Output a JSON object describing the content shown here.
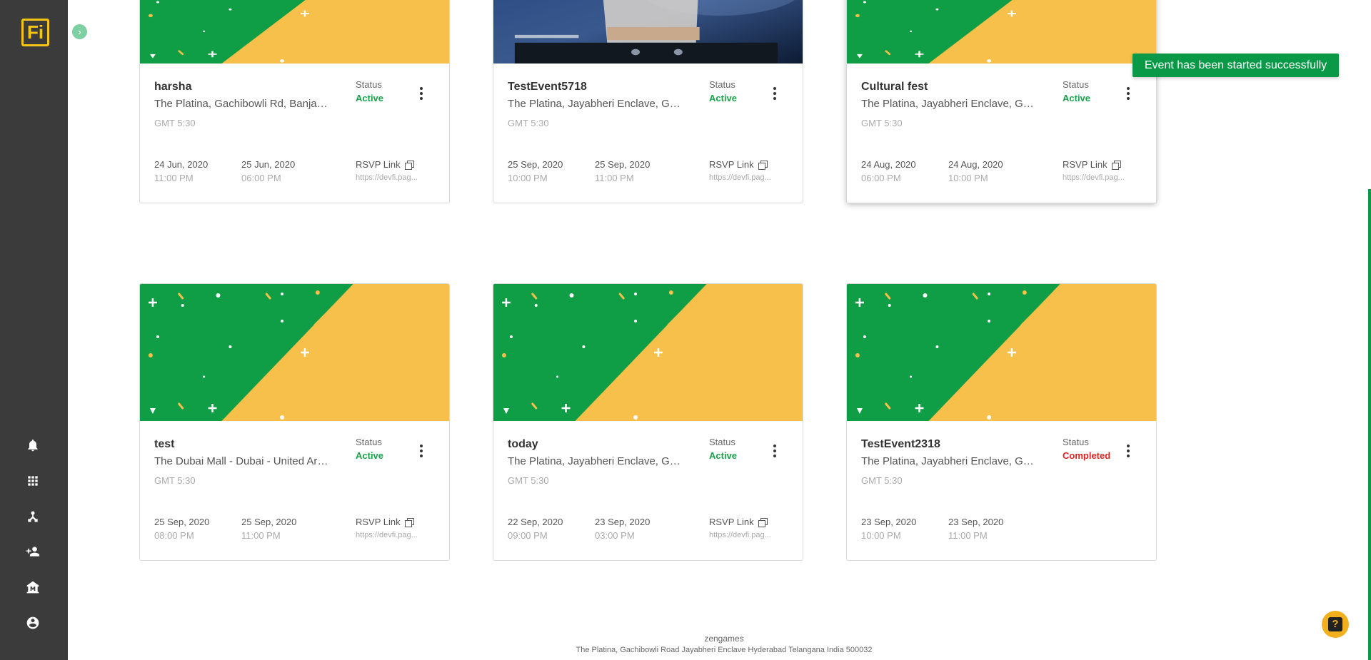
{
  "app": {
    "logo_text": "Fi",
    "toggle_glyph": "›"
  },
  "sidebar": {
    "icons": [
      "bell-icon",
      "grid-icon",
      "hub-icon",
      "add-user-icon",
      "museum-icon",
      "account-icon"
    ]
  },
  "labels": {
    "status": "Status",
    "rsvp": "RSVP Link"
  },
  "colors": {
    "accent": "#0a9a47",
    "active": "#17a34a",
    "completed": "#e02424",
    "banner_green": "#0f9d45",
    "banner_yellow": "#f7c04a"
  },
  "events": [
    {
      "name": "harsha",
      "location": "The Platina, Gachibowli Rd, Banjara Hills",
      "timezone": "GMT 5:30",
      "status": "Active",
      "start_date": "24 Jun, 2020",
      "start_time": "11:00 PM",
      "end_date": "25 Jun, 2020",
      "end_time": "06:00 PM",
      "rsvp_url": "https://devfi.pag...",
      "banner": "pattern"
    },
    {
      "name": "TestEvent5718",
      "location": "The Platina, Jayabheri Enclave, Gachibowli",
      "timezone": "GMT 5:30",
      "status": "Active",
      "start_date": "25 Sep, 2020",
      "start_time": "10:00 PM",
      "end_date": "25 Sep, 2020",
      "end_time": "11:00 PM",
      "rsvp_url": "https://devfi.pag...",
      "banner": "photo"
    },
    {
      "name": "Cultural fest",
      "location": "The Platina, Jayabheri Enclave, Gachibowli",
      "timezone": "GMT 5:30",
      "status": "Active",
      "start_date": "24 Aug, 2020",
      "start_time": "06:00 PM",
      "end_date": "24 Aug, 2020",
      "end_time": "10:00 PM",
      "rsvp_url": "https://devfi.pag...",
      "banner": "pattern"
    },
    {
      "name": "test",
      "location": "The Dubai Mall - Dubai - United Arab Emirates",
      "timezone": "GMT 5:30",
      "status": "Active",
      "start_date": "25 Sep, 2020",
      "start_time": "08:00 PM",
      "end_date": "25 Sep, 2020",
      "end_time": "11:00 PM",
      "rsvp_url": "https://devfi.pag...",
      "banner": "pattern"
    },
    {
      "name": "today",
      "location": "The Platina, Jayabheri Enclave, Gachibowli",
      "timezone": "GMT 5:30",
      "status": "Active",
      "start_date": "22 Sep, 2020",
      "start_time": "09:00 PM",
      "end_date": "23 Sep, 2020",
      "end_time": "03:00 PM",
      "rsvp_url": "https://devfi.pag...",
      "banner": "pattern"
    },
    {
      "name": "TestEvent2318",
      "location": "The Platina, Jayabheri Enclave, Gachibowli",
      "timezone": "GMT 5:30",
      "status": "Completed",
      "start_date": "23 Sep, 2020",
      "start_time": "10:00 PM",
      "end_date": "23 Sep, 2020",
      "end_time": "11:00 PM",
      "rsvp_url": "",
      "banner": "pattern"
    }
  ],
  "toast": {
    "message": "Event has been started successfully"
  },
  "footer": {
    "company": "zengames",
    "address": "The Platina, Gachibowli Road Jayabheri Enclave Hyderabad Telangana India 500032"
  },
  "help": {
    "glyph": "?"
  }
}
